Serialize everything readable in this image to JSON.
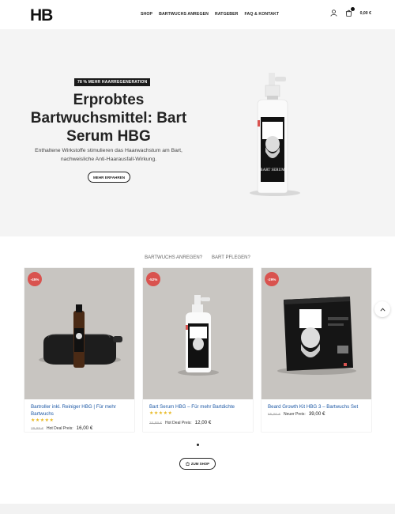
{
  "header": {
    "logo": "HB",
    "nav": [
      "SHOP",
      "BARTWUCHS ANREGEN",
      "RATGEBER",
      "FAQ & KONTAKT"
    ],
    "cart_total": "0,00 €",
    "icons": [
      "user-icon",
      "cart-icon"
    ]
  },
  "hero": {
    "badge": "78 % MEHR HAARREGENERATION",
    "title": "Erprobtes Bartwuchsmittel: Bart Serum HBG",
    "text": "Enthaltene Wirkstoffe stimulieren das Haarwachstum am Bart, nachweisliche Anti-Haarausfall-Wirkung.",
    "button": "MEHR ERFAHREN",
    "product_label": "BART SERUM"
  },
  "tabs": [
    "BARTWUCHS ANREGEN?",
    "BART PFLEGEN?"
  ],
  "products": [
    {
      "discount": "-45%",
      "title": "Bartroller inkl. Reiniger HBG | Für mehr Bartwuchs",
      "stars": "★★★★★",
      "old_price": "29,99 €",
      "price_label": "Hot Deal Preis:",
      "price": "16,00 €"
    },
    {
      "discount": "-52%",
      "title": "Bart Serum HBG – Für mehr Bartdichte",
      "stars": "★★★★★",
      "old_price": "24,99 €",
      "price_label": "Hot Deal Preis:",
      "price": "12,00 €"
    },
    {
      "discount": "-29%",
      "title": "Beard Growth Kit HBG 3 – Bartwuchs Set",
      "stars": "",
      "old_price": "55,00 €",
      "price_label": "Neuer Preis:",
      "price": "39,00 €"
    }
  ],
  "shop_button": "ZUM SHOP",
  "colors": {
    "discount": "#d9534f",
    "link": "#1f5aa6",
    "star": "#e8b923",
    "hero_bg": "#f4f4f4"
  }
}
